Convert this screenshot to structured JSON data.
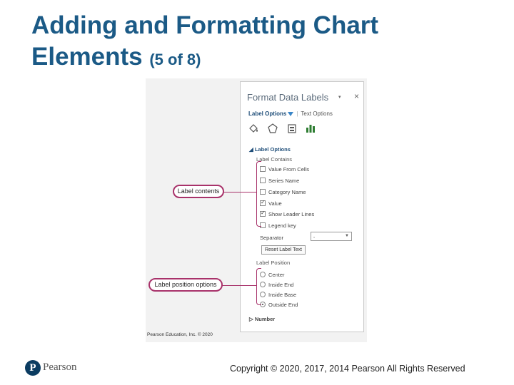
{
  "slide": {
    "title_main": "Adding and Formatting Chart Elements",
    "title_sub": "(5 of 8)"
  },
  "pane": {
    "title": "Format Data Labels",
    "dropdown_glyph": "▾",
    "close_glyph": "×",
    "tabs": [
      "Label Options",
      "Text Options"
    ],
    "icons": [
      "fill-line-icon",
      "effects-icon",
      "size-properties-icon",
      "label-options-icon"
    ],
    "section_label_options": "Label Options",
    "label_contains": "Label Contains",
    "checkboxes": [
      {
        "label": "Value From Cells",
        "checked": false
      },
      {
        "label": "Series Name",
        "checked": false
      },
      {
        "label": "Category Name",
        "checked": false
      },
      {
        "label": "Value",
        "checked": true
      },
      {
        "label": "Show Leader Lines",
        "checked": true
      },
      {
        "label": "Legend key",
        "checked": false
      }
    ],
    "separator_label": "Separator",
    "separator_value": ",",
    "reset_button": "Reset Label Text",
    "label_position": "Label Position",
    "radios": [
      {
        "label": "Center",
        "selected": false
      },
      {
        "label": "Inside End",
        "selected": false
      },
      {
        "label": "Inside Base",
        "selected": false
      },
      {
        "label": "Outside End",
        "selected": true
      }
    ],
    "section_number": "Number",
    "accent_color": "#a8326a"
  },
  "callouts": {
    "label_contents": "Label contents",
    "label_position_options": "Label position options"
  },
  "credit": "Pearson Education, Inc. © 2020",
  "footer": {
    "logo_letter": "P",
    "logo_word": "Pearson",
    "copyright": "Copyright © 2020, 2017, 2014 Pearson All Rights Reserved"
  }
}
